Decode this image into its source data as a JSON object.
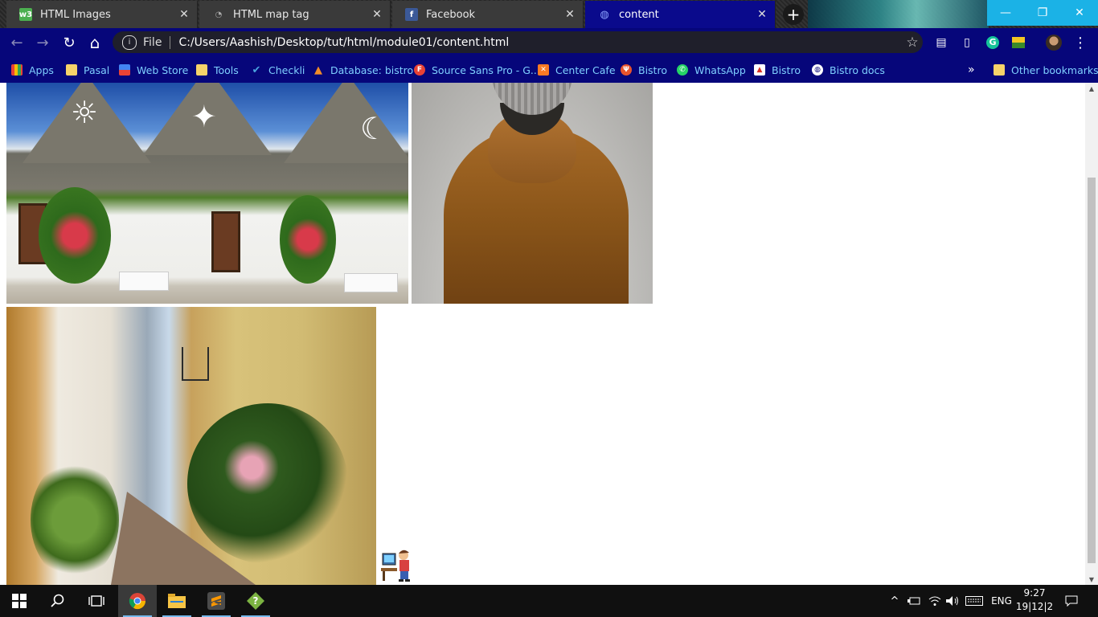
{
  "tabs": [
    {
      "title": "HTML Images",
      "favicon": "w3schools-icon",
      "close": "✕"
    },
    {
      "title": "HTML map tag",
      "favicon": "generic-page-icon",
      "close": "✕"
    },
    {
      "title": "Facebook",
      "favicon": "facebook-icon",
      "close": "✕"
    },
    {
      "title": "content",
      "favicon": "globe-icon",
      "close": "✕"
    }
  ],
  "new_tab": "+",
  "window_controls": {
    "minimize": "—",
    "restore": "❐",
    "close": "✕"
  },
  "toolbar": {
    "back": "←",
    "forward": "→",
    "reload": "↻",
    "home": "⌂",
    "scheme": "File",
    "url": "C:/Users/Aashish/Desktop/tut/html/module01/content.html",
    "star": "☆",
    "menu": "⋮"
  },
  "bookmarks": [
    {
      "label": "Apps",
      "icon": "apps-grid-icon",
      "color": "#f4b400"
    },
    {
      "label": "Pasal",
      "icon": "folder-icon",
      "color": "#f6d36a"
    },
    {
      "label": "Web Store",
      "icon": "web-store-icon",
      "color": "#e94235"
    },
    {
      "label": "Tools",
      "icon": "folder-icon",
      "color": "#f6d36a"
    },
    {
      "label": "Checkli",
      "icon": "checkmark-icon",
      "color": "#4aa3df"
    },
    {
      "label": "Database: bistro",
      "icon": "phpmyadmin-icon",
      "color": "#f28c28"
    },
    {
      "label": "Source Sans Pro - G...",
      "icon": "google-fonts-icon",
      "color": "#e94235"
    },
    {
      "label": "Center Cafe",
      "icon": "xampp-icon",
      "color": "#fb7a24"
    },
    {
      "label": "Bistro",
      "icon": "bistro-icon",
      "color": "#e8542c"
    },
    {
      "label": "WhatsApp",
      "icon": "whatsapp-icon",
      "color": "#25d366"
    },
    {
      "label": "Bistro",
      "icon": "bistro-red-icon",
      "color": "#d93025"
    },
    {
      "label": "Bistro docs",
      "icon": "globe-icon",
      "color": "#ffffff"
    }
  ],
  "bookmarks_overflow": "»",
  "other_bookmarks": "Other bookmarks",
  "taskbar": {
    "apps": [
      "windows-start-icon",
      "search-icon",
      "task-view-icon",
      "chrome-icon",
      "file-explorer-icon",
      "sublime-text-icon",
      "help-app-icon"
    ],
    "language": "ENG",
    "time": "9:27",
    "date": "19|12|2"
  }
}
